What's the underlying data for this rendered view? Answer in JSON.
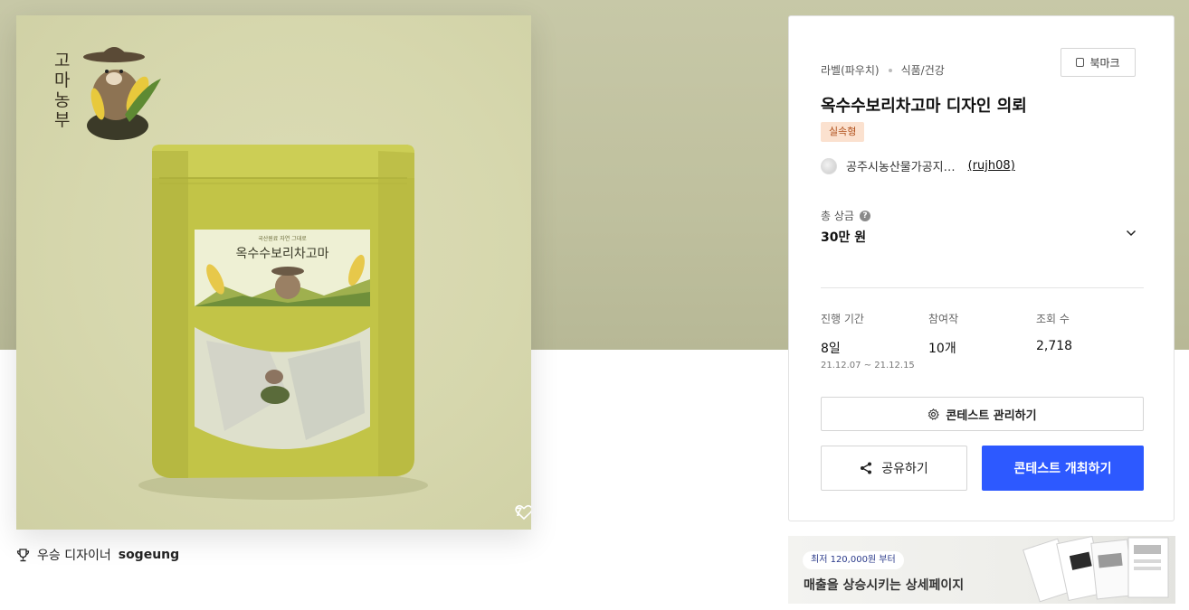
{
  "product_image": {
    "logo_text": "고마농부",
    "pouch_label": "옥수수보리차고마",
    "like_count": "7"
  },
  "winner": {
    "prefix": "우승 디자이너",
    "name": "sogeung"
  },
  "card": {
    "category": "라벨(파우치)",
    "subcategory": "식품/건강",
    "bookmark_label": "북마크",
    "title": "옥수수보리차고마 디자인 의뢰",
    "tag": "실속형",
    "host_name": "공주시농산물가공지…",
    "host_handle": "(rujh08)",
    "prize_label": "총 상금",
    "prize_value": "30만 원",
    "stats": {
      "period_label": "진행 기간",
      "period_value": "8일",
      "period_dates": "21.12.07 ~ 21.12.15",
      "entries_label": "참여작",
      "entries_value": "10개",
      "views_label": "조회 수",
      "views_value": "2,718"
    },
    "manage_label": "콘테스트 관리하기",
    "share_label": "공유하기",
    "host_contest_label": "콘테스트 개최하기"
  },
  "ad": {
    "badge": "최저 120,000원 부터",
    "text": "매출을 상승시키는 상세페이지"
  },
  "colors": {
    "accent": "#2d59ff",
    "hero_bg": "#c7c8a7",
    "tag_bg": "#fbe1cf",
    "tag_text": "#b0501b"
  }
}
